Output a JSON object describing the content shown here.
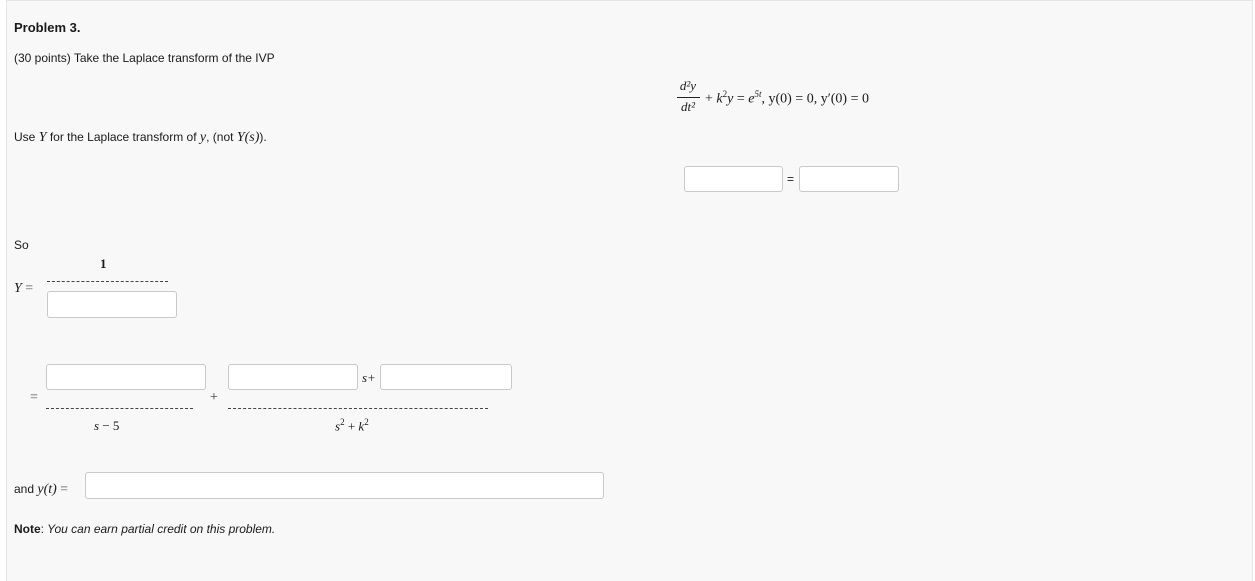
{
  "problem": {
    "title": "Problem 3.",
    "intro": "(30 points) Take the Laplace transform of the IVP",
    "use_prefix": "Use",
    "use_Y": "Y",
    "use_middle": " for the Laplace transform of ",
    "use_y": "y",
    "use_not": ", (not ",
    "use_Ys": "Y(s)",
    "use_end": ")."
  },
  "equation": {
    "num": "d²y",
    "den": "dt²",
    "rest_plus": "+ ",
    "rest_k": "k",
    "rest_k_sup": "2",
    "rest_y": "y",
    "rest_eq": " = ",
    "rest_e": "e",
    "rest_e_sup": "5t",
    "rest_conds": ", y(0) = 0, y′(0) = 0"
  },
  "transform_row": {
    "equals": "="
  },
  "solution": {
    "so": "So",
    "Y_label": "Y",
    "eq": "=",
    "numerator_one": "1",
    "second_eq": "=",
    "den1": "s − 5",
    "plus": "+",
    "s_plus": "s+",
    "den2": "s² + k²"
  },
  "answer": {
    "and_label": "and",
    "yt": "y(t)",
    "eq": "="
  },
  "note": {
    "label": "Note",
    "colon": ":",
    "text": " You can earn partial credit on this problem."
  }
}
